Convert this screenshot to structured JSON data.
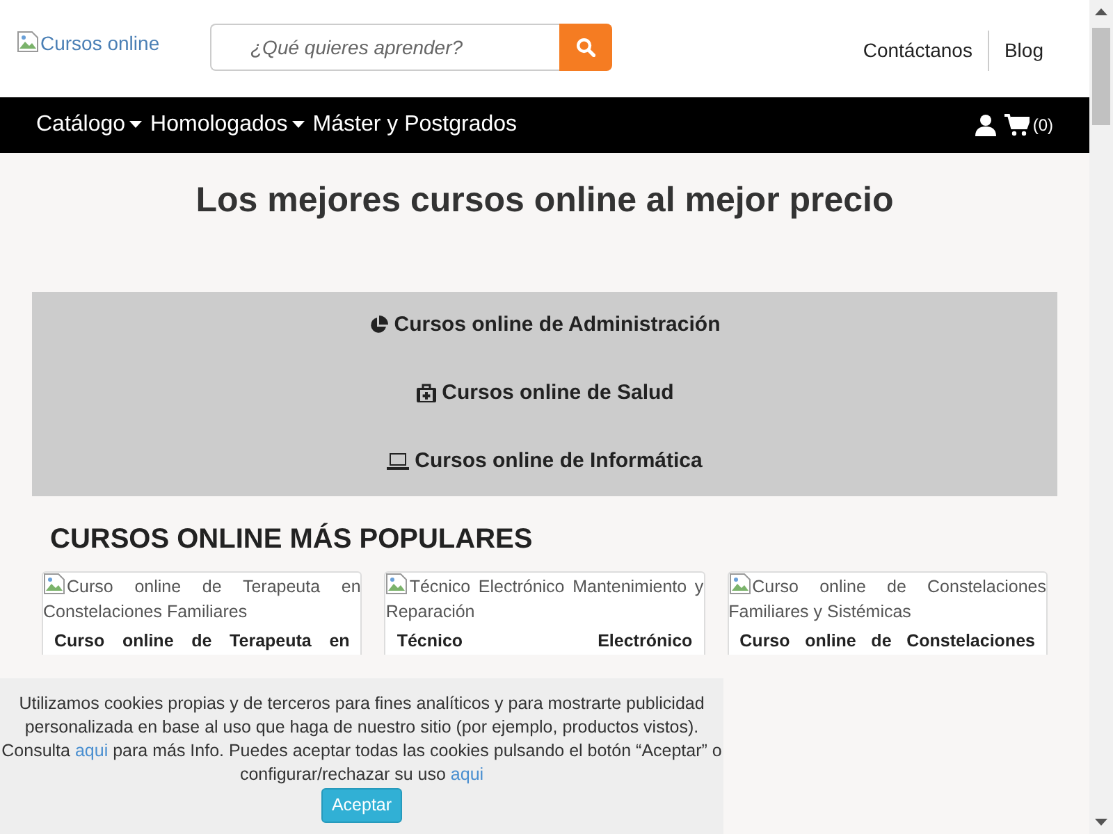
{
  "header": {
    "logo_alt": "Cursos online",
    "search": {
      "placeholder": "¿Qué quieres aprender?"
    },
    "links": [
      "Contáctanos",
      "Blog"
    ]
  },
  "nav": {
    "items": [
      {
        "label": "Catálogo",
        "dropdown": true
      },
      {
        "label": "Homologados",
        "dropdown": true
      },
      {
        "label": "Máster y Postgrados",
        "dropdown": false
      }
    ],
    "cart_count": "(0)"
  },
  "hero": {
    "title": "Los mejores cursos online al mejor precio"
  },
  "categories": [
    {
      "label": "Cursos online de Administración",
      "kind": "chart"
    },
    {
      "label": "Cursos online de Salud",
      "kind": "medkit"
    },
    {
      "label": "Cursos online de Informática",
      "kind": "laptop"
    }
  ],
  "popular": {
    "title": "CURSOS ONLINE MÁS POPULARES",
    "cards": [
      {
        "image_alt": "Curso online de Terapeuta en Constelaciones Familiares",
        "title": "Curso online de Terapeuta en"
      },
      {
        "image_alt": "Técnico Electrónico Mantenimiento y Reparación",
        "title": "Técnico Electrónico"
      },
      {
        "image_alt": "Curso online de Constelaciones Familiares y Sistémicas",
        "title": "Curso online de Constelaciones"
      }
    ]
  },
  "cookie_banner": {
    "text_before": "Utilizamos cookies propias y de terceros para fines analíticos y para mostrarte publicidad personalizada en base al uso que haga de nuestro sitio (por ejemplo, productos vistos). Consulta",
    "link_1": "aqui",
    "text_middle": "para más Info. Puedes aceptar todas las cookies pulsando el botón “Aceptar” o configurar/rechazar su uso",
    "link_2": "aqui",
    "button": "Aceptar"
  }
}
